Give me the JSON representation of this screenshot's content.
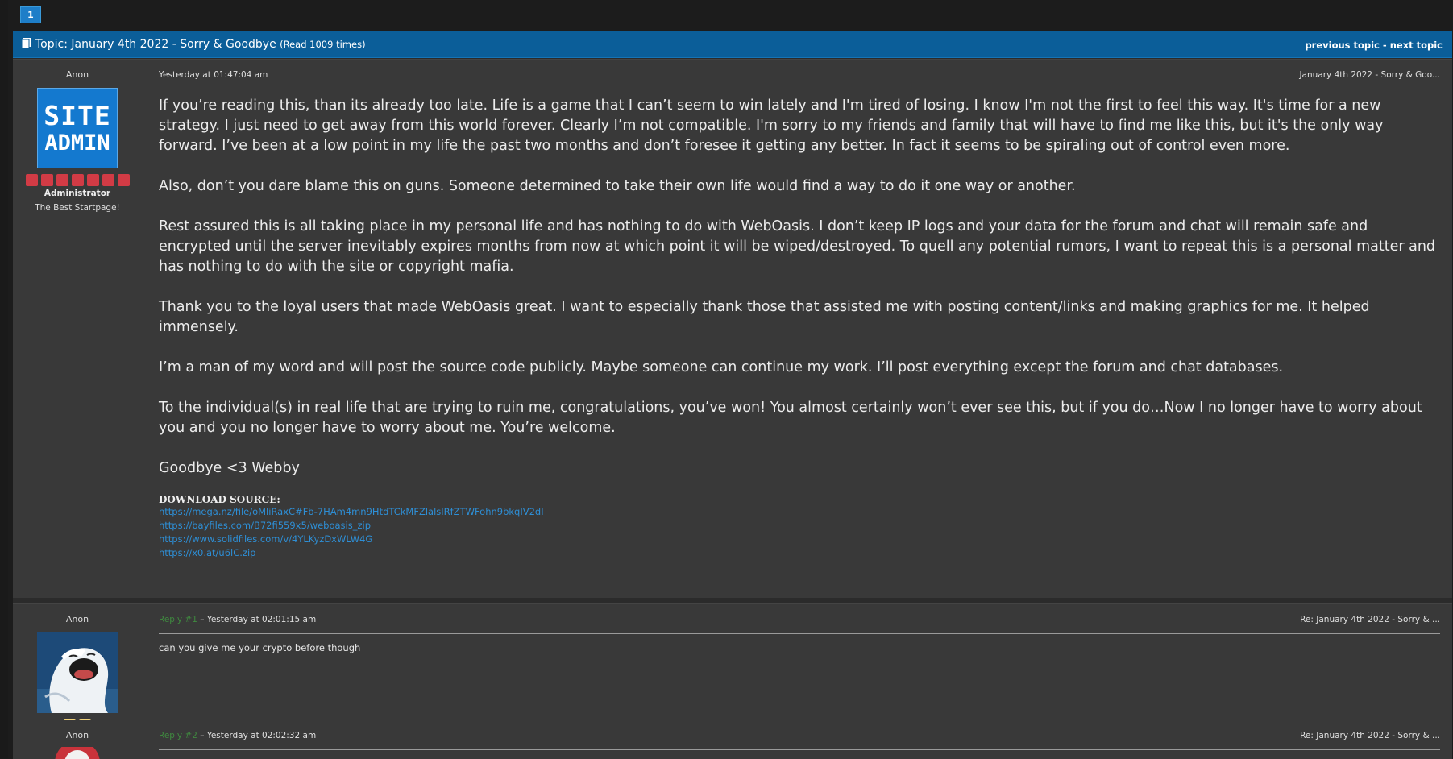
{
  "pagination": {
    "current_page": "1"
  },
  "topic": {
    "prefix": "Topic: ",
    "title": "January 4th 2022 - Sorry & Goodbye",
    "read_count": "(Read 1009 times)",
    "nav_previous": "previous topic",
    "nav_separator": " - ",
    "nav_next": "next topic"
  },
  "posts": [
    {
      "poster_name": "Anon",
      "avatar_text_line1": "SITE",
      "avatar_text_line2": "ADMIN",
      "role": "Administrator",
      "tagline": "The Best Startpage!",
      "timestamp": "Yesterday at 01:47:04 am",
      "subject": "January 4th 2022 - Sorry & Goo...",
      "paragraphs": [
        "If you’re reading this, than its already too late. Life is a game that I can’t seem to win lately and I'm tired of losing. I know I'm not the first to feel this way. It's time for a new strategy. I just need to get away from this world forever. Clearly I’m not compatible. I'm sorry to my friends and family that will have to find me like this, but it's the only way forward. I’ve been at a low point in my life the past two months and don’t foresee it getting any better. In fact it seems to be spiraling out of control even more.",
        "Also, don’t you dare blame this on guns. Someone determined to take their own life would find a way to do it one way or another.",
        "Rest assured this is all taking place in my personal life and has nothing to do with WebOasis. I don’t keep IP logs and your data for the forum and chat will remain safe and encrypted until the server inevitably expires months from now at which point it will be wiped/destroyed. To quell any potential rumors, I want to repeat this is a personal matter and has nothing to do with the site or copyright mafia.",
        "Thank you to the loyal users that made WebOasis great. I want to especially thank those that assisted me with posting content/links and making graphics for me. It helped immensely.",
        "I’m a man of my word and will post the source code publicly. Maybe someone can continue my work. I’ll post everything except the forum and chat databases.",
        "To the individual(s) in real life that are trying to ruin me, congratulations, you’ve won! You almost certainly won’t ever see this, but if you do…Now I no longer have to worry about you and you no longer have to worry about me. You’re welcome.",
        "Goodbye <3 Webby"
      ],
      "download_label": "DOWNLOAD SOURCE:",
      "download_links": [
        "https://mega.nz/file/oMliRaxC#Fb-7HAm4mn9HtdTCkMFZlalsIRfZTWFohn9bkqIV2dI",
        "https://bayfiles.com/B72fi559x5/weboasis_zip",
        "https://www.solidfiles.com/v/4YLKyzDxWLW4G",
        "https://x0.at/u6lC.zip"
      ]
    },
    {
      "poster_name": "Anon",
      "reply_label": "Reply #1",
      "timestamp": " – Yesterday at 02:01:15 am",
      "subject": "Re: January 4th 2022 - Sorry & ...",
      "body": "can you give me your crypto before though"
    },
    {
      "poster_name": "Anon",
      "reply_label": "Reply #2",
      "timestamp": " – Yesterday at 02:02:32 am",
      "subject": "Re: January 4th 2022 - Sorry & ..."
    }
  ],
  "colors": {
    "topic_bar": "#0b5e99",
    "link": "#2e8fd6",
    "reply_link": "#3f8a3f",
    "admin_star": "#d23b45",
    "member_star": "#f0d27a"
  }
}
